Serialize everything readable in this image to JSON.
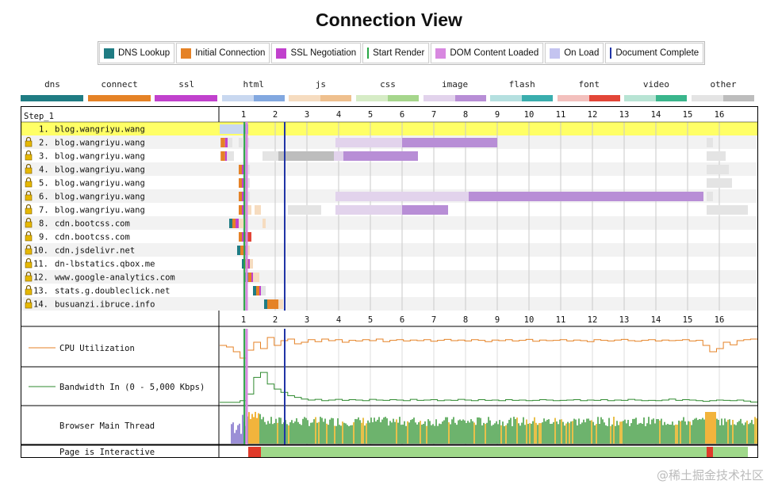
{
  "title": "Connection View",
  "legend": [
    {
      "label": "DNS Lookup",
      "color": "#1f7c83",
      "kind": "box"
    },
    {
      "label": "Initial Connection",
      "color": "#e58226",
      "kind": "box"
    },
    {
      "label": "SSL Negotiation",
      "color": "#c141cd",
      "kind": "box"
    },
    {
      "label": "Start Render",
      "color": "#28a745",
      "kind": "line"
    },
    {
      "label": "DOM Content Loaded",
      "color": "#d888e0",
      "kind": "box"
    },
    {
      "label": "On Load",
      "color": "#c4c4f0",
      "kind": "box"
    },
    {
      "label": "Document Complete",
      "color": "#2034a6",
      "kind": "line"
    }
  ],
  "content_types": [
    {
      "label": "dns",
      "c1": "#1f7c83",
      "c2": "#1f7c83"
    },
    {
      "label": "connect",
      "c1": "#e58226",
      "c2": "#e58226"
    },
    {
      "label": "ssl",
      "c1": "#c141cd",
      "c2": "#c141cd"
    },
    {
      "label": "html",
      "c1": "#c9d8f0",
      "c2": "#82a8e0"
    },
    {
      "label": "js",
      "c1": "#f6dcc0",
      "c2": "#efc08e"
    },
    {
      "label": "css",
      "c1": "#d6ecc6",
      "c2": "#a6d68c"
    },
    {
      "label": "image",
      "c1": "#e2d3ec",
      "c2": "#b88ed6"
    },
    {
      "label": "flash",
      "c1": "#b5e0e0",
      "c2": "#3aaeae"
    },
    {
      "label": "font",
      "c1": "#f3c0bd",
      "c2": "#e34638"
    },
    {
      "label": "video",
      "c1": "#b8e4d4",
      "c2": "#3ab68c"
    },
    {
      "label": "other",
      "c1": "#e4e4e4",
      "c2": "#bdbdbd"
    }
  ],
  "chart_data": {
    "type": "waterfall",
    "step_label": "Step_1",
    "x_ticks": [
      "1",
      "2",
      "3",
      "4",
      "5",
      "6",
      "7",
      "8",
      "9",
      "10",
      "11",
      "12",
      "13",
      "14",
      "15",
      "16"
    ],
    "x_unit": "seconds",
    "xlim": [
      0,
      16.9
    ],
    "start_render": 1.03,
    "dom_content_loaded": 1.1,
    "document_complete": 2.3,
    "requests": [
      {
        "num": "1.",
        "host": "blog.wangriyu.wang",
        "lock": false,
        "highlight": true,
        "segments": [
          {
            "start": 0.0,
            "end": 0.08,
            "color": "#1f7c83"
          },
          {
            "start": 0.08,
            "end": 0.15,
            "color": "#e58226"
          },
          {
            "start": 0.15,
            "end": 0.22,
            "color": "#c141cd"
          },
          {
            "start": 0.22,
            "end": 1.0,
            "color": "#c9d8f0"
          },
          {
            "start": 1.0,
            "end": 1.15,
            "color": "#82a8e0"
          }
        ]
      },
      {
        "num": "2.",
        "host": "blog.wangriyu.wang",
        "lock": true,
        "highlight": false,
        "segments": [
          {
            "start": 0.28,
            "end": 0.42,
            "color": "#e58226"
          },
          {
            "start": 0.42,
            "end": 0.5,
            "color": "#c141cd"
          },
          {
            "start": 0.5,
            "end": 0.65,
            "color": "#e4e4e4"
          },
          {
            "start": 0.85,
            "end": 1.18,
            "color": "#e4e4e4"
          },
          {
            "start": 3.9,
            "end": 6.0,
            "color": "#e2d3ec"
          },
          {
            "start": 6.0,
            "end": 9.0,
            "color": "#b88ed6"
          },
          {
            "start": 15.6,
            "end": 15.8,
            "color": "#e4e4e4"
          }
        ]
      },
      {
        "num": "3.",
        "host": "blog.wangriyu.wang",
        "lock": true,
        "highlight": false,
        "segments": [
          {
            "start": 0.28,
            "end": 0.42,
            "color": "#e58226"
          },
          {
            "start": 0.42,
            "end": 0.48,
            "color": "#c141cd"
          },
          {
            "start": 0.48,
            "end": 0.7,
            "color": "#e4e4e4"
          },
          {
            "start": 1.6,
            "end": 2.1,
            "color": "#e4e4e4"
          },
          {
            "start": 2.1,
            "end": 3.85,
            "color": "#bdbdbd"
          },
          {
            "start": 3.85,
            "end": 4.15,
            "color": "#e2d3ec"
          },
          {
            "start": 4.15,
            "end": 6.5,
            "color": "#b88ed6"
          },
          {
            "start": 15.6,
            "end": 16.2,
            "color": "#e4e4e4"
          }
        ]
      },
      {
        "num": "4.",
        "host": "blog.wangriyu.wang",
        "lock": true,
        "highlight": false,
        "segments": [
          {
            "start": 0.85,
            "end": 0.95,
            "color": "#e58226"
          },
          {
            "start": 0.95,
            "end": 1.05,
            "color": "#c141cd"
          },
          {
            "start": 1.05,
            "end": 1.2,
            "color": "#e4e4e4"
          },
          {
            "start": 15.6,
            "end": 16.3,
            "color": "#e4e4e4"
          }
        ]
      },
      {
        "num": "5.",
        "host": "blog.wangriyu.wang",
        "lock": true,
        "highlight": false,
        "segments": [
          {
            "start": 0.85,
            "end": 0.95,
            "color": "#e58226"
          },
          {
            "start": 0.95,
            "end": 1.05,
            "color": "#c141cd"
          },
          {
            "start": 1.05,
            "end": 1.2,
            "color": "#e4e4e4"
          },
          {
            "start": 15.6,
            "end": 16.4,
            "color": "#e4e4e4"
          }
        ]
      },
      {
        "num": "6.",
        "host": "blog.wangriyu.wang",
        "lock": true,
        "highlight": false,
        "segments": [
          {
            "start": 0.85,
            "end": 0.95,
            "color": "#e58226"
          },
          {
            "start": 0.95,
            "end": 1.05,
            "color": "#c141cd"
          },
          {
            "start": 1.05,
            "end": 1.2,
            "color": "#e4e4e4"
          },
          {
            "start": 3.9,
            "end": 8.1,
            "color": "#e2d3ec"
          },
          {
            "start": 8.1,
            "end": 15.5,
            "color": "#b88ed6"
          },
          {
            "start": 15.6,
            "end": 15.8,
            "color": "#e4e4e4"
          }
        ]
      },
      {
        "num": "7.",
        "host": "blog.wangriyu.wang",
        "lock": true,
        "highlight": false,
        "segments": [
          {
            "start": 0.85,
            "end": 0.95,
            "color": "#e58226"
          },
          {
            "start": 0.95,
            "end": 1.05,
            "color": "#c141cd"
          },
          {
            "start": 1.05,
            "end": 1.25,
            "color": "#f6dcc0"
          },
          {
            "start": 1.35,
            "end": 1.55,
            "color": "#f6dcc0"
          },
          {
            "start": 2.4,
            "end": 3.45,
            "color": "#e4e4e4"
          },
          {
            "start": 3.9,
            "end": 6.0,
            "color": "#e2d3ec"
          },
          {
            "start": 6.0,
            "end": 7.45,
            "color": "#b88ed6"
          },
          {
            "start": 15.6,
            "end": 16.9,
            "color": "#e4e4e4"
          }
        ]
      },
      {
        "num": "8.",
        "host": "cdn.bootcss.com",
        "lock": true,
        "highlight": false,
        "segments": [
          {
            "start": 0.55,
            "end": 0.65,
            "color": "#1f7c83"
          },
          {
            "start": 0.65,
            "end": 0.75,
            "color": "#e58226"
          },
          {
            "start": 0.75,
            "end": 0.85,
            "color": "#c141cd"
          },
          {
            "start": 0.85,
            "end": 1.1,
            "color": "#f6dcc0"
          },
          {
            "start": 1.6,
            "end": 1.7,
            "color": "#f6dcc0"
          }
        ]
      },
      {
        "num": "9.",
        "host": "cdn.bootcss.com",
        "lock": true,
        "highlight": false,
        "segments": [
          {
            "start": 0.85,
            "end": 0.95,
            "color": "#e58226"
          },
          {
            "start": 0.95,
            "end": 1.05,
            "color": "#c141cd"
          },
          {
            "start": 1.05,
            "end": 1.25,
            "color": "#e34638"
          }
        ]
      },
      {
        "num": "10.",
        "host": "cdn.jsdelivr.net",
        "lock": true,
        "highlight": false,
        "segments": [
          {
            "start": 0.8,
            "end": 0.9,
            "color": "#1f7c83"
          },
          {
            "start": 0.9,
            "end": 1.0,
            "color": "#e58226"
          },
          {
            "start": 1.0,
            "end": 1.1,
            "color": "#c141cd"
          },
          {
            "start": 1.1,
            "end": 1.2,
            "color": "#f6dcc0"
          }
        ]
      },
      {
        "num": "11.",
        "host": "dn-lbstatics.qbox.me",
        "lock": true,
        "highlight": false,
        "segments": [
          {
            "start": 0.95,
            "end": 1.05,
            "color": "#1f7c83"
          },
          {
            "start": 1.05,
            "end": 1.15,
            "color": "#e58226"
          },
          {
            "start": 1.15,
            "end": 1.2,
            "color": "#c141cd"
          },
          {
            "start": 1.2,
            "end": 1.3,
            "color": "#f6dcc0"
          }
        ]
      },
      {
        "num": "12.",
        "host": "www.google-analytics.com",
        "lock": true,
        "highlight": false,
        "segments": [
          {
            "start": 1.05,
            "end": 1.15,
            "color": "#1f7c83"
          },
          {
            "start": 1.15,
            "end": 1.25,
            "color": "#e58226"
          },
          {
            "start": 1.25,
            "end": 1.3,
            "color": "#c141cd"
          },
          {
            "start": 1.3,
            "end": 1.5,
            "color": "#f6dcc0"
          }
        ]
      },
      {
        "num": "13.",
        "host": "stats.g.doubleclick.net",
        "lock": true,
        "highlight": false,
        "segments": [
          {
            "start": 1.3,
            "end": 1.4,
            "color": "#1f7c83"
          },
          {
            "start": 1.4,
            "end": 1.5,
            "color": "#e58226"
          },
          {
            "start": 1.5,
            "end": 1.55,
            "color": "#c141cd"
          },
          {
            "start": 1.55,
            "end": 1.7,
            "color": "#e4e4e4"
          }
        ]
      },
      {
        "num": "14.",
        "host": "busuanzi.ibruce.info",
        "lock": true,
        "highlight": false,
        "segments": [
          {
            "start": 1.65,
            "end": 1.75,
            "color": "#1f7c83"
          },
          {
            "start": 1.75,
            "end": 2.1,
            "color": "#e58226"
          },
          {
            "start": 2.1,
            "end": 2.25,
            "color": "#f6dcc0"
          }
        ]
      }
    ],
    "cpu": {
      "label": "CPU Utilization",
      "color": "#e58226",
      "values": [
        60,
        55,
        40,
        20,
        45,
        70,
        50,
        85,
        60,
        75,
        80,
        65,
        70,
        78,
        72,
        80,
        75,
        78,
        70,
        76,
        74,
        78,
        75,
        80,
        72,
        76,
        78,
        74,
        77,
        75,
        78,
        73,
        76,
        79,
        75,
        77,
        74,
        78,
        76,
        72,
        77,
        75,
        78,
        74,
        76,
        79,
        73,
        77,
        75,
        76,
        78,
        74,
        77,
        75,
        72,
        78,
        76,
        74,
        77,
        79,
        75,
        73,
        76,
        78,
        74,
        77,
        75,
        76,
        78,
        74,
        76,
        60,
        40,
        50,
        70,
        62,
        75,
        78,
        80
      ]
    },
    "bandwidth": {
      "label": "Bandwidth In (0 - 5,000 Kbps)",
      "color": "#2f8a2f",
      "values": [
        5,
        5,
        5,
        10,
        30,
        80,
        95,
        60,
        45,
        35,
        25,
        20,
        15,
        12,
        14,
        10,
        12,
        14,
        11,
        13,
        12,
        10,
        14,
        12,
        11,
        13,
        12,
        10,
        14,
        11,
        12,
        13,
        10,
        12,
        11,
        14,
        12,
        10,
        13,
        11,
        12,
        10,
        13,
        11,
        12,
        10,
        11,
        13,
        12,
        10,
        11,
        12,
        13,
        10,
        12,
        11,
        13,
        10,
        12,
        11,
        14,
        12,
        10,
        11,
        10,
        12,
        15,
        11,
        13,
        12,
        10,
        8,
        10,
        12,
        11,
        10,
        12,
        9,
        6
      ]
    },
    "main_thread": {
      "label": "Browser Main Thread"
    },
    "interactive": {
      "label": "Page is Interactive",
      "blocked": [
        [
          1.15,
          1.55
        ],
        [
          15.6,
          15.8
        ]
      ],
      "interactive": [
        [
          1.55,
          15.6
        ],
        [
          15.8,
          16.9
        ]
      ]
    }
  },
  "watermark": "@稀土掘金技术社区"
}
